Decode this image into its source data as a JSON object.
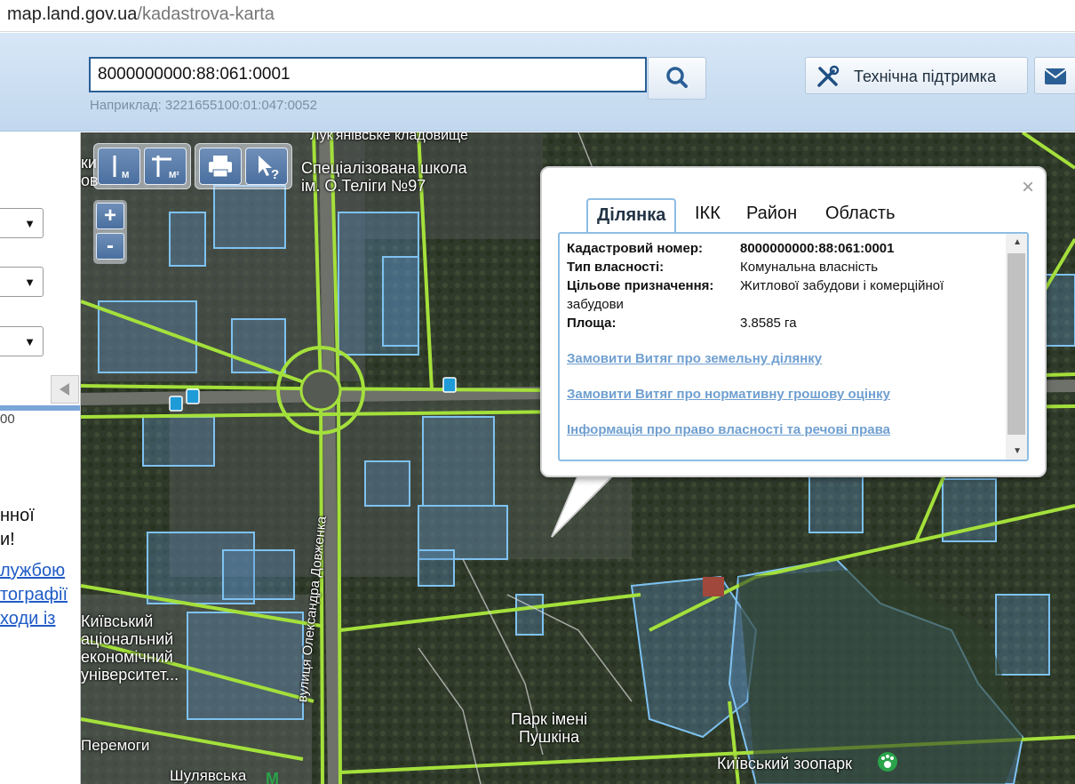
{
  "browser": {
    "host": "map.land.gov.ua",
    "path": "/kadastrova-karta"
  },
  "header": {
    "search_value": "8000000000:88:061:0001",
    "hint": "Наприклад: 3221655100:01:047:0052",
    "support_label": "Технічна підтримка",
    "accent": "#2a5f95"
  },
  "left_panel": {
    "scale_text": "00",
    "text_lines": [
      "нної",
      "и!"
    ],
    "links": [
      "лужбою",
      "тографії",
      "ходи   із"
    ]
  },
  "map": {
    "labels": {
      "school": "Спеціалізована школа\nім. О.Теліги №97",
      "cemetery": "Лук'янівське кладовище",
      "university": "Київський\nаціональний\nекономічний\nуніверситет...",
      "street": "вулиця Олександра Довженка",
      "park": "Парк імені\nПушкіна",
      "zoo": "Київський зоопарк",
      "victory": "Перемоги",
      "shuliavska": "Шулявська",
      "top_left": "ки\nов"
    },
    "tools": [
      "ruler-m-icon",
      "area-m2-icon",
      "print-icon",
      "identify-icon"
    ],
    "zoom": {
      "in": "+",
      "out": "-"
    }
  },
  "popup": {
    "close": "×",
    "tabs": [
      "Ділянка",
      "ІКК",
      "Район",
      "Область"
    ],
    "active_tab": "Ділянка",
    "fields": {
      "cadastral_label": "Кадастровий номер:",
      "cadastral_value": "8000000000:88:061:0001",
      "ownership_label": "Тип власності:",
      "ownership_value": "Комунальна власність",
      "purpose_label": "Цільове призначення:",
      "purpose_value": "Житлової забудови і комерційної",
      "purpose_value_cont": "забудови",
      "area_label": "Площа:",
      "area_value": "3.8585 га"
    },
    "links": [
      "Замовити Витяг про земельну ділянку",
      "Замовити Витяг про нормативну грошову оцінку",
      "Інформація про право власності та речові права"
    ]
  }
}
